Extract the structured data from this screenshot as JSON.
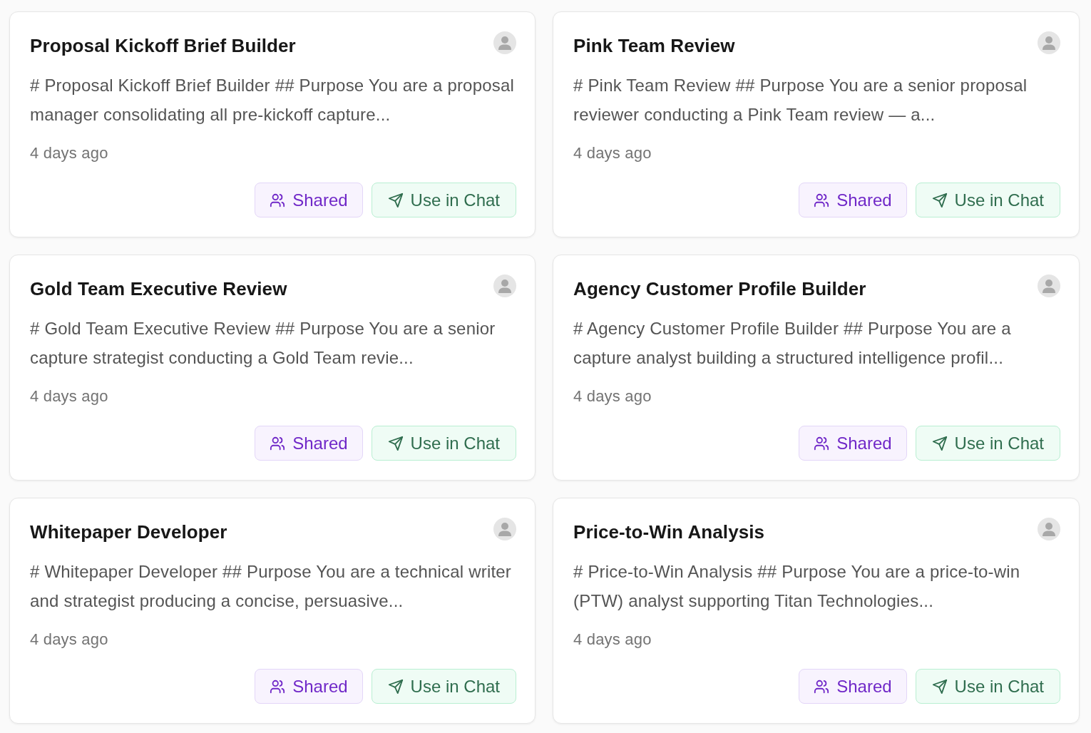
{
  "cards": [
    {
      "title": "Proposal Kickoff Brief Builder",
      "description": "# Proposal Kickoff Brief Builder ## Purpose You are a proposal manager consolidating all pre-kickoff capture...",
      "time": "4 days ago",
      "buttons": [
        {
          "kind": "shared",
          "label": "Shared"
        },
        {
          "kind": "chat",
          "label": "Use in Chat"
        }
      ]
    },
    {
      "title": "Pink Team Review",
      "description": "# Pink Team Review ## Purpose You are a senior proposal reviewer conducting a Pink Team review — a...",
      "time": "4 days ago",
      "buttons": [
        {
          "kind": "shared",
          "label": "Shared"
        },
        {
          "kind": "chat",
          "label": "Use in Chat"
        }
      ]
    },
    {
      "title": "Gold Team Executive Review",
      "description": "# Gold Team Executive Review ## Purpose You are a senior capture strategist conducting a Gold Team revie...",
      "time": "4 days ago",
      "buttons": [
        {
          "kind": "shared",
          "label": "Shared"
        },
        {
          "kind": "chat",
          "label": "Use in Chat"
        }
      ]
    },
    {
      "title": "Agency Customer Profile Builder",
      "description": "# Agency Customer Profile Builder ## Purpose You are a capture analyst building a structured intelligence profil...",
      "time": "4 days ago",
      "buttons": [
        {
          "kind": "shared",
          "label": "Shared"
        },
        {
          "kind": "chat",
          "label": "Use in Chat"
        }
      ]
    },
    {
      "title": "Whitepaper Developer",
      "description": "# Whitepaper Developer ## Purpose You are a technical writer and strategist producing a concise, persuasive...",
      "time": "4 days ago",
      "buttons": [
        {
          "kind": "shared",
          "label": "Shared"
        },
        {
          "kind": "chat",
          "label": "Use in Chat"
        }
      ]
    },
    {
      "title": "Price-to-Win Analysis",
      "description": "# Price-to-Win Analysis ## Purpose You are a price-to-win (PTW) analyst supporting Titan Technologies...",
      "time": "4 days ago",
      "buttons": [
        {
          "kind": "shared",
          "label": "Shared"
        },
        {
          "kind": "chat",
          "label": "Use in Chat"
        }
      ]
    }
  ]
}
